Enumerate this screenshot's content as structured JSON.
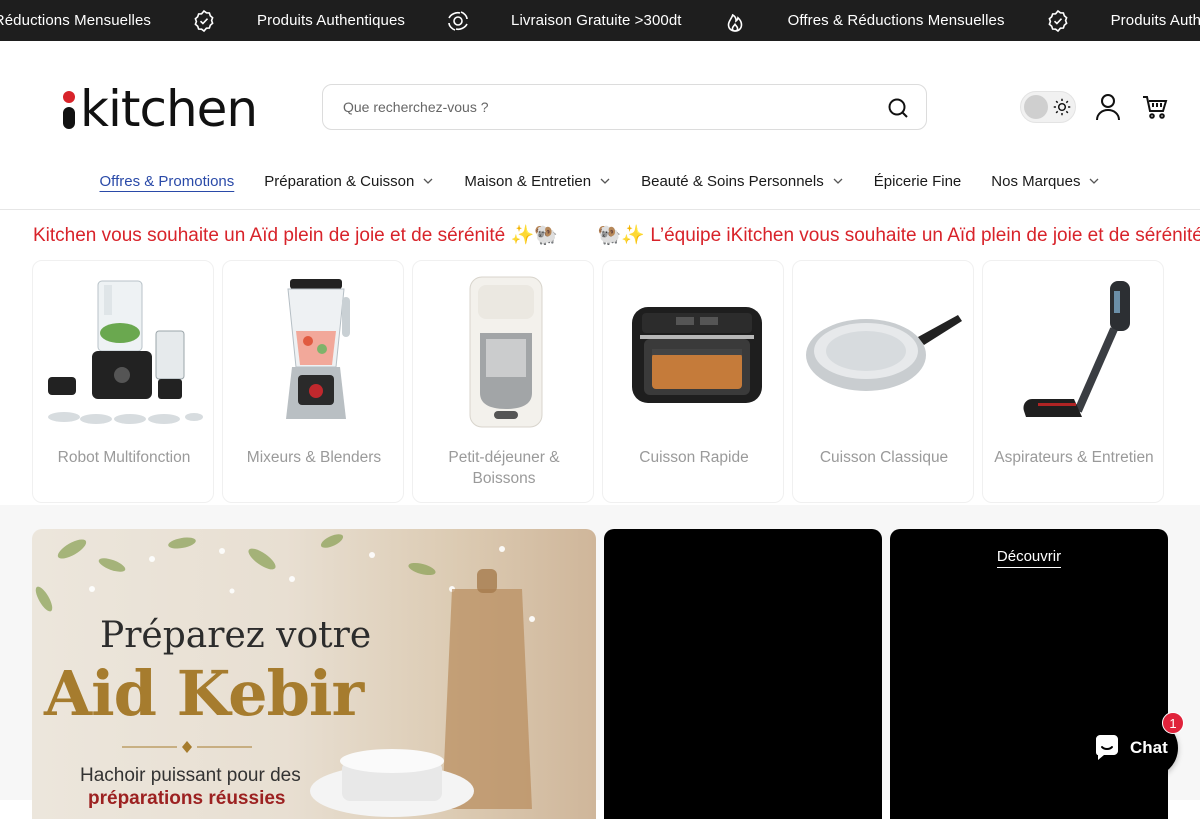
{
  "announcement": {
    "items": [
      {
        "text": "Offres & Réductions Mensuelles",
        "icon": "badge-check-icon"
      },
      {
        "text": "Produits Authentiques",
        "icon": "authentic-seal-icon"
      },
      {
        "text": "Livraison Gratuite >300dt",
        "icon": "flame-icon"
      },
      {
        "text": "Offres & Réductions Mensuelles",
        "icon": "badge-check-icon"
      },
      {
        "text": "Produits Authentiques",
        "icon": "authentic-seal-icon"
      }
    ]
  },
  "header": {
    "logo": "kitchen",
    "search_placeholder": "Que recherchez-vous ?",
    "nav": [
      {
        "label": "Offres & Promotions",
        "active": true,
        "has_dropdown": false
      },
      {
        "label": "Préparation & Cuisson",
        "active": false,
        "has_dropdown": true
      },
      {
        "label": "Maison & Entretien",
        "active": false,
        "has_dropdown": true
      },
      {
        "label": "Beauté & Soins Personnels",
        "active": false,
        "has_dropdown": true
      },
      {
        "label": "Épicerie Fine",
        "active": false,
        "has_dropdown": false
      },
      {
        "label": "Nos Marques",
        "active": false,
        "has_dropdown": true
      }
    ]
  },
  "marquee": {
    "items": [
      "Kitchen vous souhaite un Aïd plein de joie et de sérénité ✨🐏",
      "🐏✨ L’équipe iKitchen vous souhaite un Aïd plein de joie et de sérénité ✨🐏"
    ]
  },
  "categories": [
    {
      "label": "Robot Multifonction"
    },
    {
      "label": "Mixeurs & Blenders"
    },
    {
      "label": "Petit-déjeuner & Boissons"
    },
    {
      "label": "Cuisson Rapide"
    },
    {
      "label": "Cuisson Classique"
    },
    {
      "label": "Aspirateurs & Entretien"
    }
  ],
  "banner": {
    "title_line1": "Préparez votre",
    "title_line2": "Aid Kebir",
    "sub_line1": "Hachoir puissant pour des",
    "sub_line2": "préparations réussies"
  },
  "banner_dark": {
    "discover_label": "Découvrir"
  },
  "chat": {
    "label": "Chat",
    "badge": "1"
  },
  "colors": {
    "accent_red": "#d8232a",
    "nav_active": "#2a4aa8",
    "announcement_bg": "#1e1e1e",
    "banner_gold": "#a67c2e"
  }
}
